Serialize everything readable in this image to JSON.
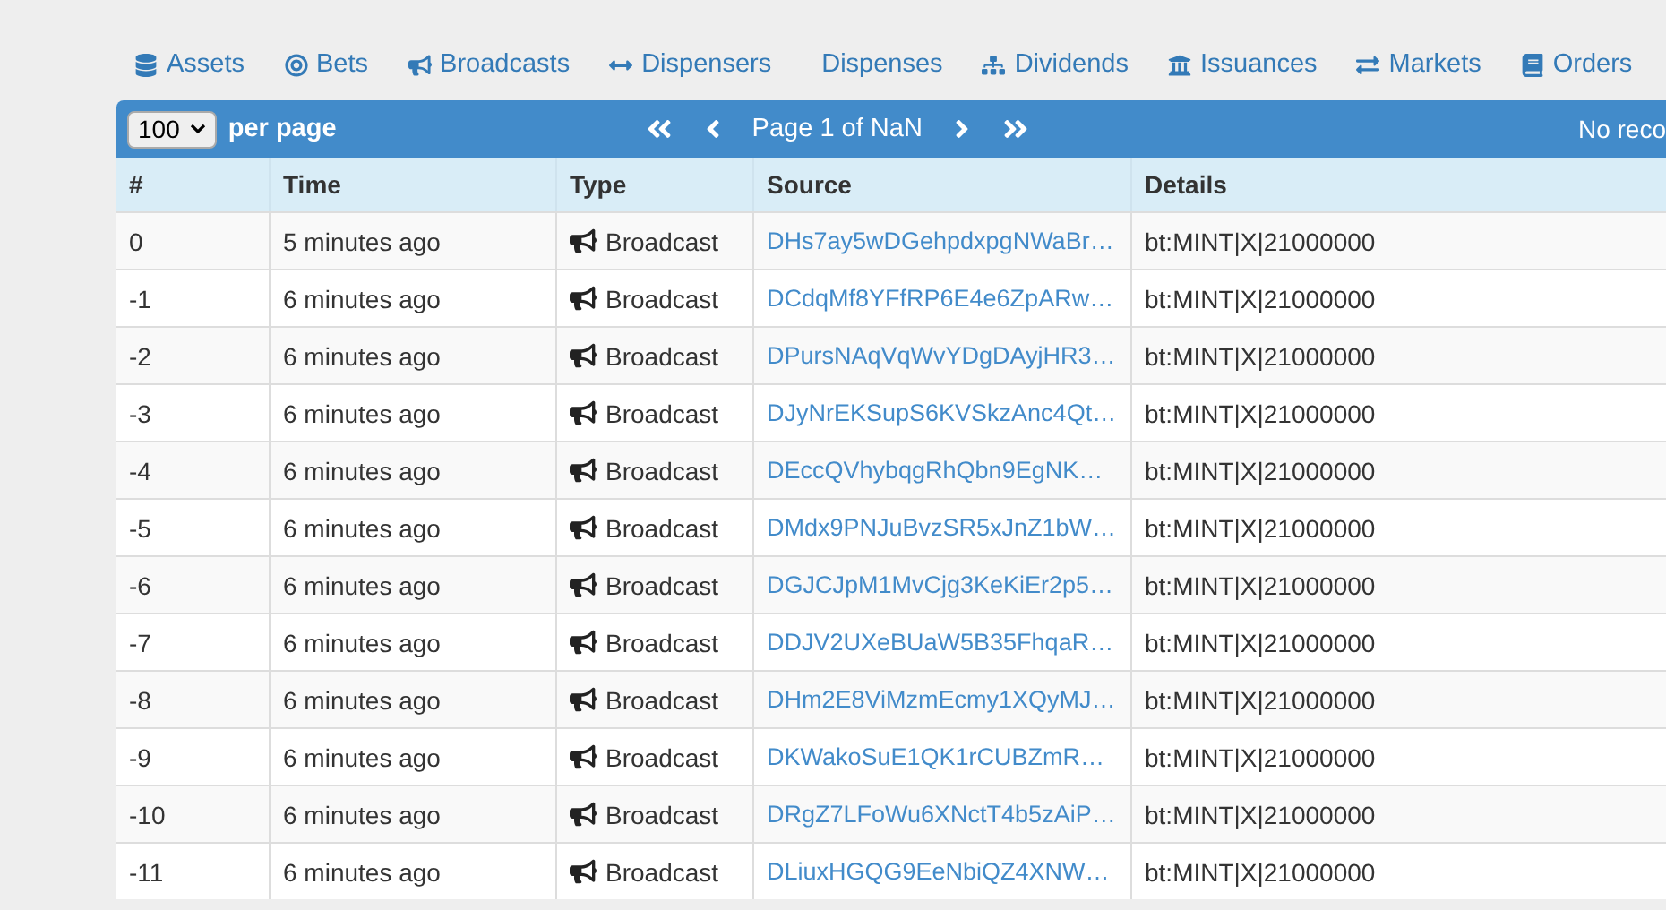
{
  "nav": [
    {
      "label": "Assets"
    },
    {
      "label": "Bets"
    },
    {
      "label": "Broadcasts"
    },
    {
      "label": "Dispensers"
    },
    {
      "label": "Dispenses"
    },
    {
      "label": "Dividends"
    },
    {
      "label": "Issuances"
    },
    {
      "label": "Markets"
    },
    {
      "label": "Orders"
    }
  ],
  "toolbar": {
    "per_page": "100",
    "per_page_label": "per page",
    "page": "Page 1 of NaN",
    "records": "No reco"
  },
  "table": {
    "columns": [
      "#",
      "Time",
      "Type",
      "Source",
      "Details"
    ],
    "rows": [
      {
        "index": "0",
        "time": "5 minutes ago",
        "type": "Broadcast",
        "source": "DHs7ay5wDGehpdxpgNWaBr…",
        "details": "bt:MINT|X|21000000"
      },
      {
        "index": "-1",
        "time": "6 minutes ago",
        "type": "Broadcast",
        "source": "DCdqMf8YFfRP6E4e6ZpARw…",
        "details": "bt:MINT|X|21000000"
      },
      {
        "index": "-2",
        "time": "6 minutes ago",
        "type": "Broadcast",
        "source": "DPursNAqVqWvYDgDAyjHR3…",
        "details": "bt:MINT|X|21000000"
      },
      {
        "index": "-3",
        "time": "6 minutes ago",
        "type": "Broadcast",
        "source": "DJyNrEKSupS6KVSkzAnc4Qt…",
        "details": "bt:MINT|X|21000000"
      },
      {
        "index": "-4",
        "time": "6 minutes ago",
        "type": "Broadcast",
        "source": "DEccQVhybqgRhQbn9EgNK…",
        "details": "bt:MINT|X|21000000"
      },
      {
        "index": "-5",
        "time": "6 minutes ago",
        "type": "Broadcast",
        "source": "DMdx9PNJuBvzSR5xJnZ1bW…",
        "details": "bt:MINT|X|21000000"
      },
      {
        "index": "-6",
        "time": "6 minutes ago",
        "type": "Broadcast",
        "source": "DGJCJpM1MvCjg3KeKiEr2p5…",
        "details": "bt:MINT|X|21000000"
      },
      {
        "index": "-7",
        "time": "6 minutes ago",
        "type": "Broadcast",
        "source": "DDJV2UXeBUaW5B35FhqaR…",
        "details": "bt:MINT|X|21000000"
      },
      {
        "index": "-8",
        "time": "6 minutes ago",
        "type": "Broadcast",
        "source": "DHm2E8ViMzmEcmy1XQyMJ…",
        "details": "bt:MINT|X|21000000"
      },
      {
        "index": "-9",
        "time": "6 minutes ago",
        "type": "Broadcast",
        "source": "DKWakoSuE1QK1rCUBZmR…",
        "details": "bt:MINT|X|21000000"
      },
      {
        "index": "-10",
        "time": "6 minutes ago",
        "type": "Broadcast",
        "source": "DRgZ7LFoWu6XNctT4b5zAiP…",
        "details": "bt:MINT|X|21000000"
      },
      {
        "index": "-11",
        "time": "6 minutes ago",
        "type": "Broadcast",
        "source": "DLiuxHGQG9EeNbiQZ4XNW…",
        "details": "bt:MINT|X|21000000"
      }
    ]
  }
}
